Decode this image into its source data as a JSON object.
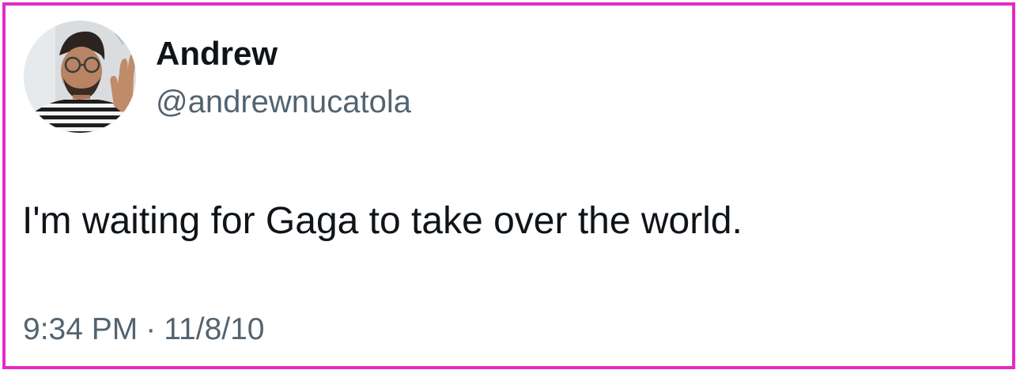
{
  "tweet": {
    "author": {
      "display_name": "Andrew",
      "handle": "@andrewnucatola",
      "avatar_icon": "profile-photo"
    },
    "text": "I'm waiting for Gaga to take over the world.",
    "time": "9:34 PM",
    "separator": "·",
    "date": "11/8/10"
  },
  "colors": {
    "frame_border": "#e52ac4",
    "primary_text": "#0f1419",
    "secondary_text": "#536471"
  }
}
